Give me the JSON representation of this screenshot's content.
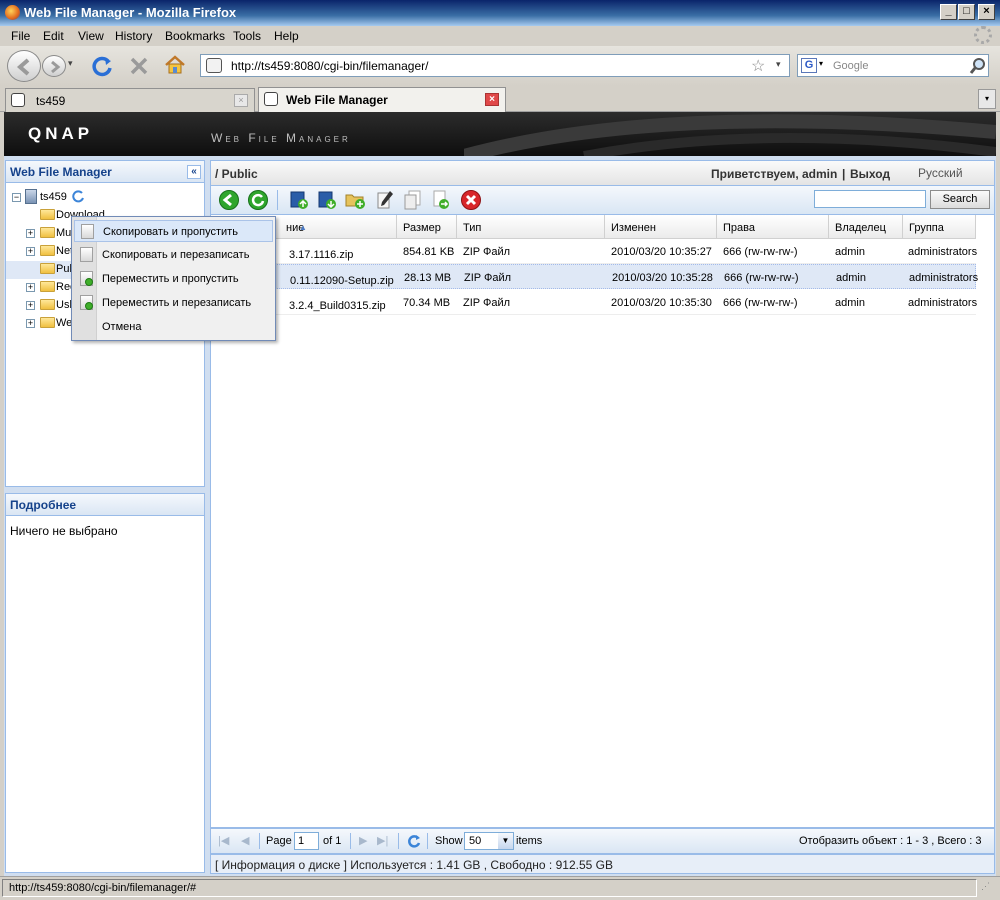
{
  "window": {
    "title": "Web File Manager - Mozilla Firefox"
  },
  "menubar": [
    "File",
    "Edit",
    "View",
    "History",
    "Bookmarks",
    "Tools",
    "Help"
  ],
  "navbar": {
    "url": "http://ts459:8080/cgi-bin/filemanager/",
    "search_placeholder": "Google"
  },
  "tabs": [
    {
      "label": "ts459",
      "active": false
    },
    {
      "label": "Web File Manager",
      "active": true
    }
  ],
  "banner": {
    "logo": "QNAP",
    "subtitle": "Web File Manager"
  },
  "tree_panel": {
    "title": "Web File Manager",
    "root": "ts459",
    "items": [
      "Download",
      "Mul",
      "Net",
      "Pub",
      "Rec",
      "Usb",
      "We"
    ]
  },
  "details_panel": {
    "title": "Подробнее",
    "text": "Ничего не выбрано"
  },
  "path": "/ Public",
  "user": {
    "greeting": "Приветствуем, admin",
    "separator": "|",
    "logout": "Выход",
    "language": "Русский"
  },
  "search": {
    "button": "Search",
    "value": ""
  },
  "grid": {
    "columns": [
      "ние",
      "Размер",
      "Тип",
      "Изменен",
      "Права",
      "Владелец",
      "Группа"
    ],
    "rows": [
      {
        "name": "3.17.1116.zip",
        "size": "854.81 KB",
        "type": "ZIP Файл",
        "modified": "2010/03/20 10:35:27",
        "perm": "666 (rw-rw-rw-)",
        "owner": "admin",
        "group": "administrators",
        "selected": false
      },
      {
        "name": "0.11.12090-Setup.zip",
        "size": "28.13 MB",
        "type": "ZIP Файл",
        "modified": "2010/03/20 10:35:28",
        "perm": "666 (rw-rw-rw-)",
        "owner": "admin",
        "group": "administrators",
        "selected": true
      },
      {
        "name": "3.2.4_Build0315.zip",
        "size": "70.34 MB",
        "type": "ZIP Файл",
        "modified": "2010/03/20 10:35:30",
        "perm": "666 (rw-rw-rw-)",
        "owner": "admin",
        "group": "administrators",
        "selected": false
      }
    ]
  },
  "pager": {
    "page_label": "Page",
    "page_value": "1",
    "of_label": "of 1",
    "show_label": "Show",
    "show_value": "50",
    "items_label": "items",
    "summary": "Отобразить объект : 1 - 3 , Всего : 3"
  },
  "disk_info": "[ Информация о диске ] Используется : 1.41 GB , Свободно : 912.55 GB",
  "context_menu": [
    {
      "label": "Скопировать и пропустить",
      "highlighted": true
    },
    {
      "label": "Скопировать и перезаписать",
      "highlighted": false
    },
    {
      "label": "Переместить и пропустить",
      "highlighted": false
    },
    {
      "label": "Переместить и перезаписать",
      "highlighted": false
    },
    {
      "label": "Отмена",
      "highlighted": false
    }
  ],
  "statusbar": "http://ts459:8080/cgi-bin/filemanager/#"
}
